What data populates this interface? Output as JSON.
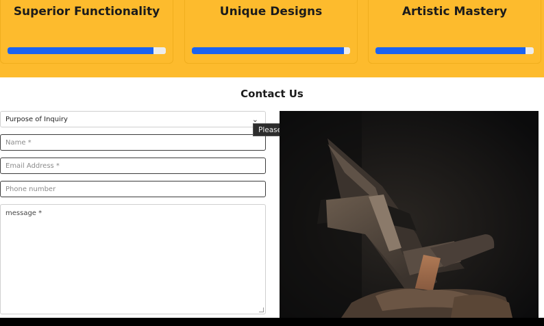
{
  "features": {
    "cards": [
      {
        "title": "Superior Functionality",
        "progress": 0.92
      },
      {
        "title": "Unique Designs",
        "progress": 0.96
      },
      {
        "title": "Artistic Mastery",
        "progress": 0.95
      }
    ]
  },
  "contact": {
    "title": "Contact Us",
    "purpose_select": {
      "value": "Purpose of Inquiry",
      "icon": "chevron-down-icon"
    },
    "name_field": {
      "placeholder": "Name *"
    },
    "email_field": {
      "placeholder": "Email Address *"
    },
    "phone_field": {
      "placeholder": "Phone number"
    },
    "message_field": {
      "placeholder": "message *"
    },
    "validation_tooltip": "Please select an item in the list."
  },
  "colors": {
    "feature_band": "#fdbb2d",
    "progress_fill": "#1b63f0",
    "progress_track": "#ececec"
  }
}
